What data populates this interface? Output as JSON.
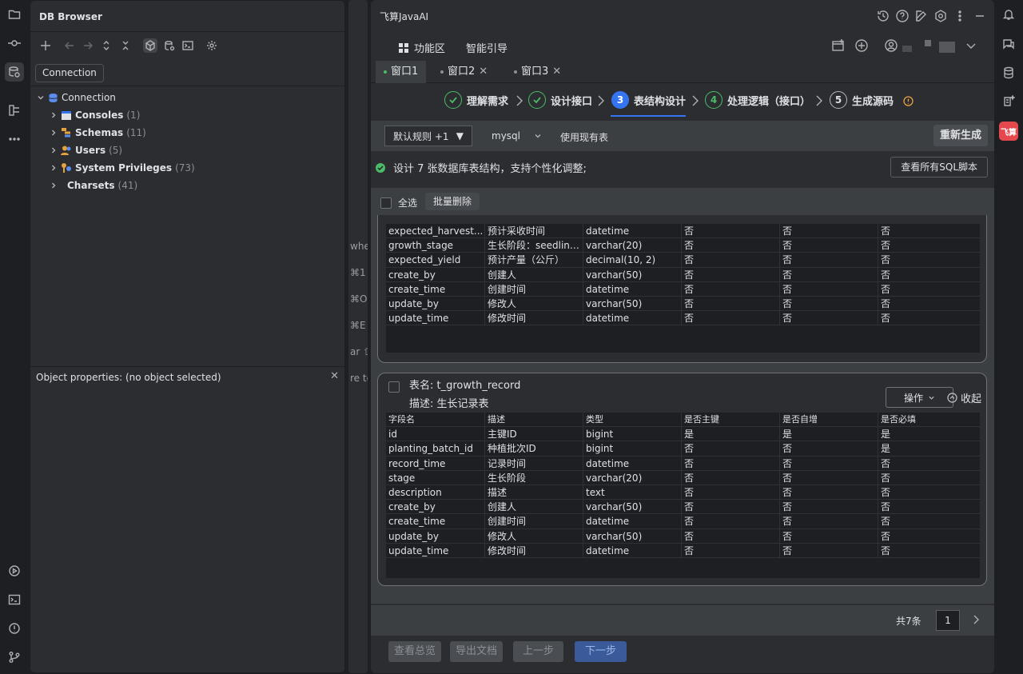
{
  "db_browser": {
    "title": "DB Browser",
    "connection_button": "Connection",
    "tree": [
      {
        "label": "Connection",
        "count": ""
      },
      {
        "label": "Consoles",
        "count": "(1)"
      },
      {
        "label": "Schemas",
        "count": "(11)"
      },
      {
        "label": "Users",
        "count": "(5)"
      },
      {
        "label": "System Privileges",
        "count": "(73)"
      },
      {
        "label": "Charsets",
        "count": "(41)"
      }
    ],
    "props_label": "Object properties:   (no object selected)"
  },
  "editor_fragments": [
    "whe",
    "⌘1",
    "⌘O",
    "⌘E",
    "ar ⇧",
    "re to"
  ],
  "plugin": {
    "title": "飞算JavaAI",
    "func_label": "功能区",
    "guide_label": "智能引导",
    "tabs": [
      "窗口1",
      "窗口2",
      "窗口3"
    ],
    "steps": [
      {
        "num": "✓",
        "label": "理解需求"
      },
      {
        "num": "✓",
        "label": "设计接口"
      },
      {
        "num": "3",
        "label": "表结构设计"
      },
      {
        "num": "4",
        "label": "处理逻辑（接口）"
      },
      {
        "num": "5",
        "label": "生成源码"
      }
    ],
    "rule_select": "默认规则 +1",
    "db_select": "mysql",
    "use_existing": "使用现有表",
    "regen": "重新生成",
    "message": "设计 7 张数据库表结构，支持个性化调整;",
    "view_sql": "查看所有SQL脚本",
    "select_all": "全选",
    "batch_delete": "批量删除",
    "table1_rows": [
      [
        "expected_harvest...",
        "预计采收时间",
        "datetime",
        "否",
        "否",
        "否"
      ],
      [
        "growth_stage",
        "生长阶段：seedling...",
        "varchar(20)",
        "否",
        "否",
        "否"
      ],
      [
        "expected_yield",
        "预计产量（公斤）",
        "decimal(10, 2)",
        "否",
        "否",
        "否"
      ],
      [
        "create_by",
        "创建人",
        "varchar(50)",
        "否",
        "否",
        "否"
      ],
      [
        "create_time",
        "创建时间",
        "datetime",
        "否",
        "否",
        "否"
      ],
      [
        "update_by",
        "修改人",
        "varchar(50)",
        "否",
        "否",
        "否"
      ],
      [
        "update_time",
        "修改时间",
        "datetime",
        "否",
        "否",
        "否"
      ]
    ],
    "table2": {
      "name": "表名: t_growth_record",
      "desc": "描述: 生长记录表",
      "ops": "操作",
      "collapse": "收起",
      "headers": [
        "字段名",
        "描述",
        "类型",
        "是否主键",
        "是否自增",
        "是否必填"
      ],
      "rows": [
        [
          "id",
          "主键ID",
          "bigint",
          "是",
          "是",
          "是"
        ],
        [
          "planting_batch_id",
          "种植批次ID",
          "bigint",
          "否",
          "否",
          "是"
        ],
        [
          "record_time",
          "记录时间",
          "datetime",
          "否",
          "否",
          "否"
        ],
        [
          "stage",
          "生长阶段",
          "varchar(20)",
          "否",
          "否",
          "否"
        ],
        [
          "description",
          "描述",
          "text",
          "否",
          "否",
          "否"
        ],
        [
          "create_by",
          "创建人",
          "varchar(50)",
          "否",
          "否",
          "否"
        ],
        [
          "create_time",
          "创建时间",
          "datetime",
          "否",
          "否",
          "否"
        ],
        [
          "update_by",
          "修改人",
          "varchar(50)",
          "否",
          "否",
          "否"
        ],
        [
          "update_time",
          "修改时间",
          "datetime",
          "否",
          "否",
          "否"
        ]
      ]
    },
    "total": "共7条",
    "page": "1",
    "buttons": [
      "查看总览",
      "导出文档",
      "上一步",
      "下一步"
    ]
  },
  "colors": {
    "accent": "#3574f0",
    "success": "#4cbb67",
    "warning": "#e6a23c",
    "brand": "#e5484d"
  }
}
